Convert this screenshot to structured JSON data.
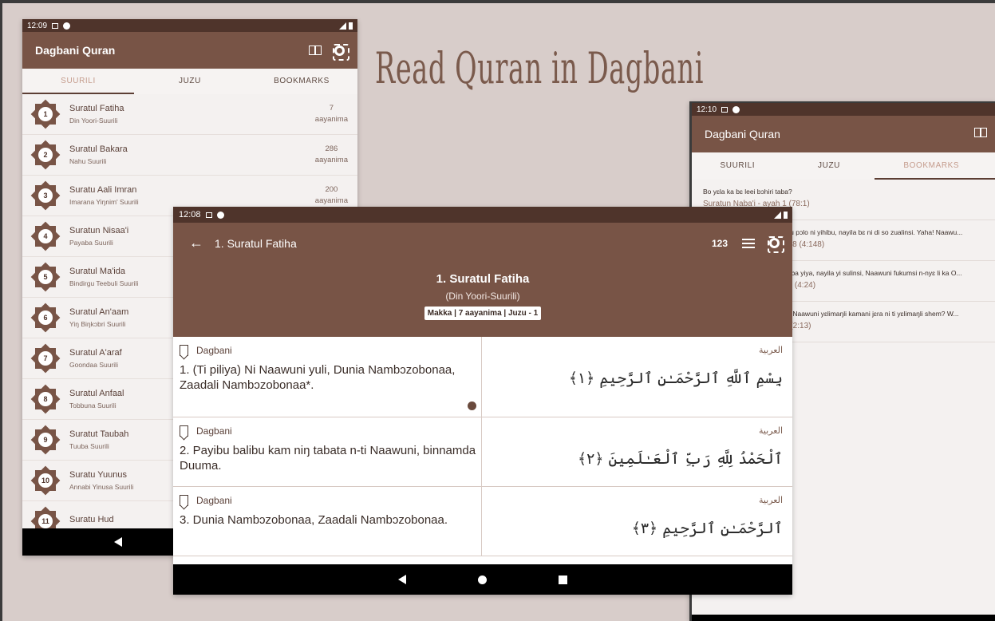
{
  "promo": {
    "title": "Read Quran in Dagbani"
  },
  "left_phone": {
    "status_time": "12:09",
    "app_title": "Dagbani Quran",
    "tabs": [
      "SUURILI",
      "JUZU",
      "BOOKMARKS"
    ],
    "surahs": [
      {
        "num": "1",
        "name": "Suratul Fatiha",
        "sub": "Din Yoori-Suurili",
        "count": "7",
        "unit": "aayanima"
      },
      {
        "num": "2",
        "name": "Suratul Bakara",
        "sub": "Nahu Suurili",
        "count": "286",
        "unit": "aayanima"
      },
      {
        "num": "3",
        "name": "Suratu Aali Imran",
        "sub": "Imarana Yiŋnim' Suurili",
        "count": "200",
        "unit": "aayanima"
      },
      {
        "num": "4",
        "name": "Suratun Nisaa'i",
        "sub": "Payaba Suurili",
        "count": "",
        "unit": ""
      },
      {
        "num": "5",
        "name": "Suratul Ma'ida",
        "sub": "Bindirgu Teebuli Suurili",
        "count": "",
        "unit": ""
      },
      {
        "num": "6",
        "name": "Suratul An'aam",
        "sub": "Yiŋ Biŋkɔbri Suurili",
        "count": "",
        "unit": ""
      },
      {
        "num": "7",
        "name": "Suratul A'araf",
        "sub": "Goondaa Suurili",
        "count": "",
        "unit": ""
      },
      {
        "num": "8",
        "name": "Suratul Anfaal",
        "sub": "Tobbuna Suurili",
        "count": "",
        "unit": ""
      },
      {
        "num": "9",
        "name": "Suratut Taubah",
        "sub": "Tuuba Suurili",
        "count": "",
        "unit": ""
      },
      {
        "num": "10",
        "name": "Suratu Yuunus",
        "sub": "Annabi Yinusa Suurili",
        "count": "",
        "unit": ""
      },
      {
        "num": "11",
        "name": "Suratu Hud",
        "sub": "",
        "count": "",
        "unit": ""
      }
    ]
  },
  "right_phone": {
    "status_time": "12:10",
    "app_title": "Dagbani Quran",
    "tabs": [
      "SUURILI",
      "JUZU",
      "BOOKMARKS"
    ],
    "bookmarks": [
      {
        "text": "Bo yɛla ka bɛ leei bɔhiri taba?",
        "ref": "Suratun Naba'i - ayah 1 (78:1)"
      },
      {
        "text": "ɛyu pɔlo ni yihibu, nayila bɛ ni di so zualinsi. Yaha! Naawu...",
        "ref": "148 (4:148)"
      },
      {
        "text": "obba yiya, nayila yi sulinsi, Naawuni fukumsi n-nyɛ li ka O...",
        "ref": "24 (4:24)"
      },
      {
        "text": "ya Naawuni yɛlimaŋli kamani jɛra ni ti yɛlimaŋli shem? W...",
        "ref": "3 (2:13)"
      }
    ]
  },
  "tablet": {
    "status_time": "12:08",
    "back_title": "1. Suratul Fatiha",
    "ayah_count_btn": "123",
    "header": {
      "title": "1. Suratul Fatiha",
      "subtitle": "(Din Yoori-Suurili)",
      "meta": "Makka | 7 aayanima | Juzu - 1"
    },
    "ayahs": [
      {
        "lang": "Dagbani",
        "trans": "1. (Ti piliya) Ni Naawuni yuli, Dunia Nambɔzobonaa, Zaadali Nambɔzobonaa*.",
        "ar_label": "العربية",
        "arabic": "بِسْمِ ٱللَّهِ ٱلرَّحْمَـٰنِ ٱلرَّحِيمِ ﴿١﴾"
      },
      {
        "lang": "Dagbani",
        "trans": "2. Payibu balibu kam niŋ tabata n-ti Naawuni, binnamda Duuma.",
        "ar_label": "العربية",
        "arabic": "ٱلْحَمْدُ لِلَّهِ رَبِّ ٱلْعَـٰلَمِينَ ﴿٢﴾"
      },
      {
        "lang": "Dagbani",
        "trans": "3. Dunia Nambɔzobonaa, Zaadali Nambɔzobonaa.",
        "ar_label": "العربية",
        "arabic": "ٱلرَّحْمَـٰنِ ٱلرَّحِيمِ ﴿٣﴾"
      }
    ]
  },
  "colors": {
    "appbar": "#785446",
    "status": "#4f342b",
    "background": "#d8cdca"
  }
}
